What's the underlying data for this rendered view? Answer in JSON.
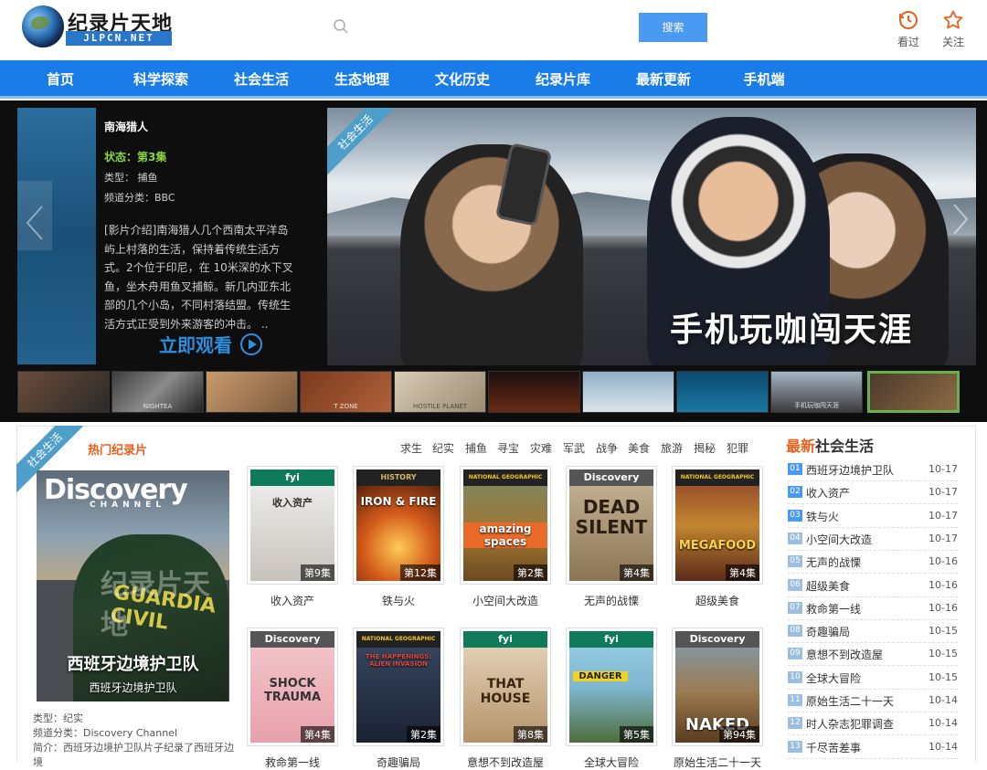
{
  "site": {
    "name_cn": "纪录片天地",
    "name_en": "JLPCN.NET"
  },
  "search": {
    "placeholder": "",
    "button": "搜索"
  },
  "top_actions": [
    {
      "label": "看过",
      "icon": "history-icon"
    },
    {
      "label": "关注",
      "icon": "star-icon"
    }
  ],
  "nav": [
    "首页",
    "科学探索",
    "社会生活",
    "生态地理",
    "文化历史",
    "纪录片库",
    "最新更新",
    "手机端"
  ],
  "banner": {
    "title": "南海猎人",
    "status": "状态：第3集",
    "type": "类型：   捕鱼",
    "channel": "频道分类：BBC",
    "desc": "[影片介绍]南海猎人几个西南太平洋岛屿上村落的生活，保持着传统生活方式。2个位于印尼，在 10米深的水下叉鱼，坐木舟用鱼叉捕鲸。新几内亚东北部的几个小岛，不同村落结盟。传统生活方式正受到外来游客的冲击。 ..",
    "watch": "立即观看",
    "ribbon": "社会生活",
    "caption": "手机玩咖闯天涯",
    "thumbs": [
      "",
      "NIGHTEA",
      "",
      "T ZONE",
      "HOSTILE PLANET",
      "",
      "",
      "",
      "手机玩咖闯天涯",
      ""
    ]
  },
  "section": {
    "ribbon": "社会生活",
    "hot_label": "热门纪录片",
    "tags": [
      "求生",
      "纪实",
      "捕鱼",
      "寻宝",
      "灾难",
      "军武",
      "战争",
      "美食",
      "旅游",
      "揭秘",
      "犯罪"
    ],
    "featured": {
      "logo": "Discovery",
      "logo_sub": "CHANNEL",
      "badge_text": "GUARDIA CIVIL",
      "watermark": "纪录片天地",
      "title_big": "西班牙边境护卫队",
      "title_small": "西班牙边境护卫队",
      "type": "类型：纪实",
      "channel": "频道分类：Discovery Channel",
      "desc": "简介：西班牙边境护卫队片子纪录了西班牙边境"
    },
    "cards": [
      {
        "logo": "fyi",
        "art": "收入资产",
        "ep": "第9集",
        "caption": "收入资产"
      },
      {
        "logo": "HISTORY",
        "art": "IRON & FIRE",
        "ep": "第12集",
        "caption": "铁与火"
      },
      {
        "logo": "NATIONAL GEOGRAPHIC",
        "art": "amazing spaces",
        "ep": "第2集",
        "caption": "小空间大改造"
      },
      {
        "logo": "Discovery",
        "art": "DEAD SILENT",
        "ep": "第4集",
        "caption": "无声的战慄"
      },
      {
        "logo": "NATIONAL GEOGRAPHIC",
        "art": "MEGAFOOD",
        "ep": "第4集",
        "caption": "超级美食"
      },
      {
        "logo": "Discovery",
        "art": "SHOCK TRAUMA",
        "ep": "第4集",
        "caption": "救命第一线"
      },
      {
        "logo": "NATIONAL GEOGRAPHIC",
        "art": "THE HAPPENINGS: ALIEN INVASION",
        "ep": "第2集",
        "caption": "奇趣骗局"
      },
      {
        "logo": "fyi",
        "art": "THAT HOUSE",
        "ep": "第8集",
        "caption": "意想不到改造屋"
      },
      {
        "logo": "fyi",
        "art": "DANGER",
        "ep": "第5集",
        "caption": "全球大冒险"
      },
      {
        "logo": "Discovery",
        "art": "NAKED",
        "ep": "第94集",
        "caption": "原始生活二十一天"
      }
    ]
  },
  "sidebar": {
    "title_hl": "最新",
    "title_rest": "社会生活",
    "items": [
      {
        "num": "01",
        "name": "西班牙边境护卫队",
        "date": "10-17"
      },
      {
        "num": "02",
        "name": "收入资产",
        "date": "10-17"
      },
      {
        "num": "03",
        "name": "铁与火",
        "date": "10-17"
      },
      {
        "num": "04",
        "name": "小空间大改造",
        "date": "10-17"
      },
      {
        "num": "05",
        "name": "无声的战慄",
        "date": "10-16"
      },
      {
        "num": "06",
        "name": "超级美食",
        "date": "10-16"
      },
      {
        "num": "07",
        "name": "救命第一线",
        "date": "10-16"
      },
      {
        "num": "08",
        "name": "奇趣骗局",
        "date": "10-15"
      },
      {
        "num": "09",
        "name": "意想不到改造屋",
        "date": "10-15"
      },
      {
        "num": "10",
        "name": "全球大冒险",
        "date": "10-15"
      },
      {
        "num": "11",
        "name": "原始生活二十一天",
        "date": "10-14"
      },
      {
        "num": "12",
        "name": "时人杂志犯罪调查",
        "date": "10-14"
      },
      {
        "num": "13",
        "name": "千尽苦差事",
        "date": "10-14"
      }
    ]
  },
  "colors": {
    "nav": "#1a7ce8",
    "accent": "#e8601c",
    "button": "#4b9af1"
  }
}
